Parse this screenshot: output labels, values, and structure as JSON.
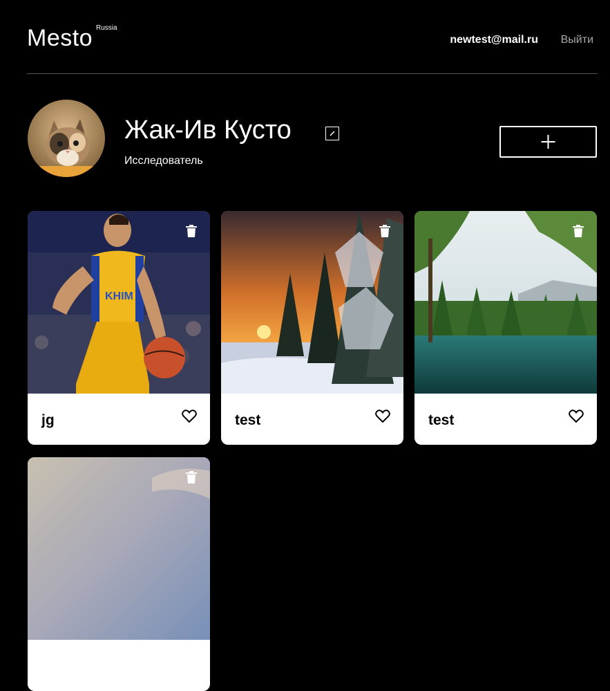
{
  "header": {
    "logo": "Mesto",
    "logo_sup": "Russia",
    "email": "newtest@mail.ru",
    "logout": "Выйти"
  },
  "profile": {
    "name": "Жак-Ив Кусто",
    "about": "Исследователь"
  },
  "cards": [
    {
      "title": "jg"
    },
    {
      "title": "test"
    },
    {
      "title": "test"
    },
    {
      "title": ""
    }
  ],
  "colors": {
    "background": "#000000",
    "divider": "#545454",
    "logout_text": "#a9a9a9",
    "card_bg": "#ffffff"
  },
  "icons": [
    "edit-icon",
    "plus-icon",
    "trash-icon",
    "heart-icon"
  ]
}
